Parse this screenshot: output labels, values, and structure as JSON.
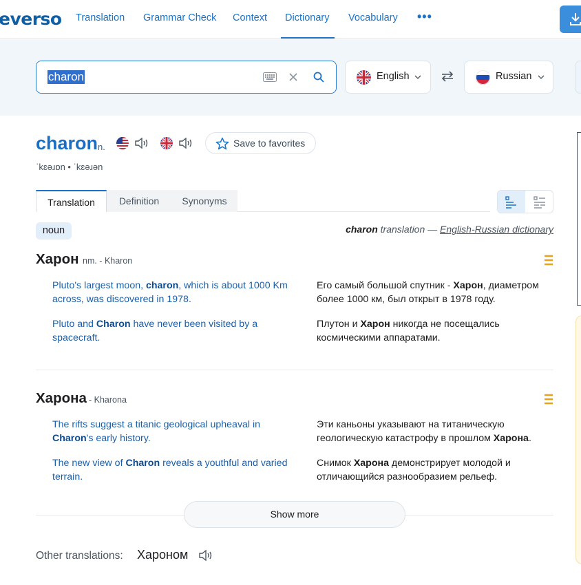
{
  "nav": {
    "logo": "everso",
    "items": [
      "Translation",
      "Grammar Check",
      "Context",
      "Dictionary",
      "Vocabulary"
    ],
    "active": "Dictionary",
    "more": "•••"
  },
  "search": {
    "value": "charon",
    "source_lang": "English",
    "target_lang": "Russian"
  },
  "entry": {
    "headword": "charon",
    "pos_abbr": "n.",
    "ipa": "ˈkɛəɹɒn • ˈkɛəɹən",
    "save_label": "Save to favorites"
  },
  "tabs": [
    "Translation",
    "Definition",
    "Synonyms"
  ],
  "noun_badge": "noun",
  "dict_ref": {
    "word": "charon",
    "middle": " translation — ",
    "link": "English-Russian dictionary"
  },
  "senses": [
    {
      "word": "Харон",
      "meta": "nm. - Kharon",
      "examples": [
        {
          "en": [
            "Pluto's largest moon, ",
            "charon",
            ", which is about 1000 Km across, was discovered in 1978."
          ],
          "ru": [
            "Его самый большой спутник - ",
            "Харон",
            ", диаметром более 1000 км, был открыт в 1978 году."
          ]
        },
        {
          "en": [
            "Pluto and ",
            "Charon",
            " have never been visited by a spacecraft."
          ],
          "ru": [
            "Плутон и ",
            "Харон",
            " никогда не посещались космическими аппаратами."
          ]
        }
      ]
    },
    {
      "word": "Харона",
      "meta": "- Kharona",
      "examples": [
        {
          "en": [
            "The rifts suggest a titanic geological upheaval in ",
            "Charon",
            "'s early history."
          ],
          "ru": [
            "Эти каньоны указывают на титаническую геологическую катастрофу в прошлом ",
            "Харона",
            "."
          ]
        },
        {
          "en": [
            "The new view of ",
            "Charon",
            " reveals a youthful and varied terrain."
          ],
          "ru": [
            "Снимок ",
            "Харона",
            " демонстрирует молодой и отличающийся разнообразием рельеф."
          ]
        }
      ]
    }
  ],
  "show_more": "Show more",
  "other_translations": {
    "label": "Other translations:",
    "word": "Хароном"
  },
  "colors": {
    "brand_blue": "#1a73c9",
    "accent_orange": "#e8a21a"
  }
}
